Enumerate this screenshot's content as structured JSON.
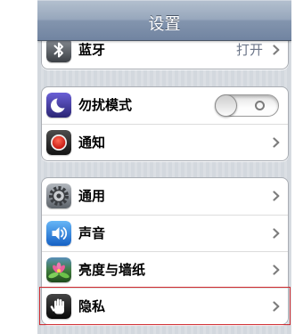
{
  "nav": {
    "title": "设置"
  },
  "groups": [
    {
      "rows": [
        {
          "label": "蓝牙",
          "icon": "bluetooth-icon",
          "value": "打开",
          "accessory_icon": "chevron-right-icon"
        }
      ]
    },
    {
      "rows": [
        {
          "label": "勿扰模式",
          "icon": "moon-icon",
          "switch_on": false
        },
        {
          "label": "通知",
          "icon": "notification-icon",
          "accessory_icon": "chevron-right-icon"
        }
      ]
    },
    {
      "rows": [
        {
          "label": "通用",
          "icon": "gear-icon",
          "accessory_icon": "chevron-right-icon"
        },
        {
          "label": "声音",
          "icon": "speaker-icon",
          "accessory_icon": "chevron-right-icon"
        },
        {
          "label": "亮度与墙纸",
          "icon": "flower-icon",
          "accessory_icon": "chevron-right-icon"
        },
        {
          "label": "隐私",
          "icon": "hand-icon",
          "accessory_icon": "chevron-right-icon",
          "highlighted": true
        }
      ]
    }
  ],
  "colors": {
    "nav_bar": "#8395ae",
    "background": "#d6dbe1",
    "value_text": "#6b7588",
    "highlight_border": "#cf2a2f"
  }
}
